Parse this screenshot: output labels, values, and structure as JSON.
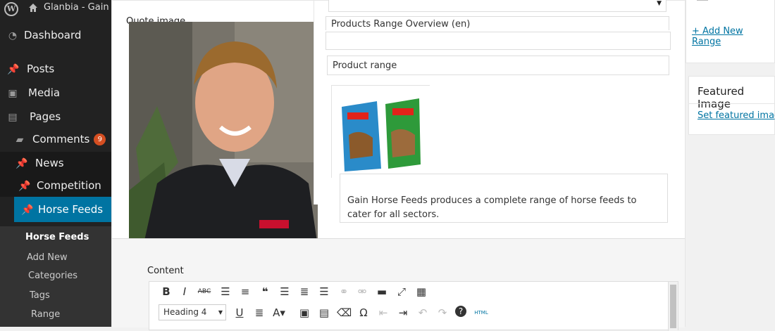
{
  "adminbar": {
    "site_name": "Glanbia - Gain"
  },
  "sidebar": {
    "items": [
      {
        "label": "Dashboard"
      },
      {
        "label": "Posts"
      },
      {
        "label": "Media"
      },
      {
        "label": "Pages"
      },
      {
        "label": "Comments",
        "badge": "9"
      },
      {
        "label": "News"
      },
      {
        "label": "Competition"
      },
      {
        "label": "Horse Feeds"
      }
    ],
    "submenu": [
      "Horse Feeds",
      "Add New",
      "Categories",
      "Tags",
      "Range"
    ]
  },
  "main": {
    "quote_image_label": "Quote image",
    "fields": {
      "title_value": "Products Range Overview (en)",
      "subtitle_value": "Product range",
      "description": "Gain Horse Feeds produces a complete range of horse feeds to cater for all sectors."
    },
    "content_label": "Content",
    "editor": {
      "format_selected": "Heading 4",
      "html_button": "HTML"
    }
  },
  "rightcol": {
    "add_range_link": "+ Add New Range",
    "featured_title": "Featured Image",
    "featured_link": "Set featured image"
  },
  "colors": {
    "active_menu": "#0074a2",
    "badge": "#d54e21",
    "link": "#0074a2"
  }
}
